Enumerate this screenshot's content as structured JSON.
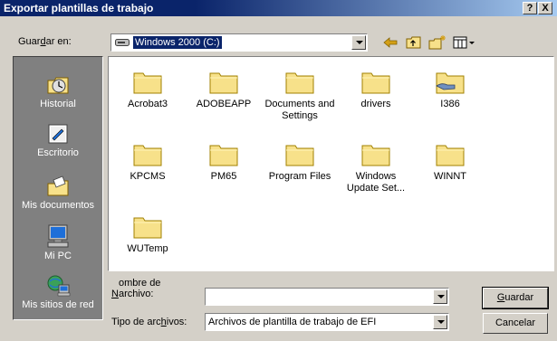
{
  "window": {
    "title": "Exportar plantillas de trabajo",
    "help_label": "?",
    "close_label": "X"
  },
  "lookin": {
    "label_pre": "Guar",
    "label_u": "d",
    "label_post": "ar en:",
    "value": "Windows 2000 (C:)"
  },
  "places": [
    {
      "label": "Historial",
      "icon": "history-icon"
    },
    {
      "label": "Escritorio",
      "icon": "desktop-icon"
    },
    {
      "label": "Mis documentos",
      "icon": "my-documents-icon"
    },
    {
      "label": "Mi PC",
      "icon": "my-computer-icon"
    },
    {
      "label": "Mis sitios de red",
      "icon": "network-places-icon"
    }
  ],
  "files": [
    {
      "name": "Acrobat3"
    },
    {
      "name": "ADOBEAPP"
    },
    {
      "name": "Documents and Settings"
    },
    {
      "name": "drivers"
    },
    {
      "name": "I386"
    },
    {
      "name": "KPCMS"
    },
    {
      "name": "PM65"
    },
    {
      "name": "Program Files"
    },
    {
      "name": "Windows Update Set..."
    },
    {
      "name": "WINNT"
    },
    {
      "name": "WUTemp"
    }
  ],
  "form": {
    "filename_label_u": "N",
    "filename_label_post": "ombre de archivo:",
    "filename_value": "",
    "filetype_label_pre": "Tipo de arc",
    "filetype_label_u": "h",
    "filetype_label_post": "ivos:",
    "filetype_value": "Archivos de plantilla de trabajo de EFI",
    "save_u": "G",
    "save_post": "uardar",
    "cancel_label": "Cancelar"
  }
}
